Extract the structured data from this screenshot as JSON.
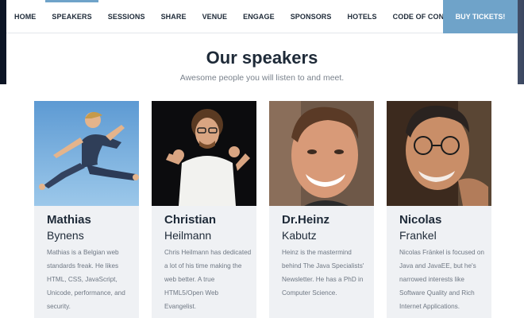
{
  "nav": {
    "items": [
      "HOME",
      "SPEAKERS",
      "SESSIONS",
      "SHARE",
      "VENUE",
      "ENGAGE",
      "SPONSORS",
      "HOTELS",
      "CODE OF CONDUCT"
    ],
    "active": "SPEAKERS",
    "buy_label": "BUY TICKETS!"
  },
  "section": {
    "title_light": "Our",
    "title_bold": "speakers",
    "subtitle": "Awesome people you will listen to and meet."
  },
  "speakers": [
    {
      "first_name": "Mathias",
      "last_name": "Bynens",
      "bio": "Mathias is a Belgian web standards freak. He likes HTML, CSS, JavaScript, Unicode, performance, and security."
    },
    {
      "first_name": "Christian",
      "last_name": "Heilmann",
      "bio": "Chris Heilmann has dedicated a lot of his time making the web better. A true HTML5/Open Web Evangelist."
    },
    {
      "first_name": "Dr.Heinz",
      "last_name": "Kabutz",
      "bio": "Heinz is the mastermind behind The Java Specialists' Newsletter. He has a PhD in Computer Science."
    },
    {
      "first_name": "Nicolas",
      "last_name": "Frankel",
      "bio": "Nicolas Fränkel is focused on Java and JavaEE, but he's narrowed interests like Software Quality and Rich Internet Applications."
    }
  ],
  "colors": {
    "accent": "#6fa3c9",
    "heading": "#1e2a38",
    "card_bg": "#eff1f4"
  }
}
